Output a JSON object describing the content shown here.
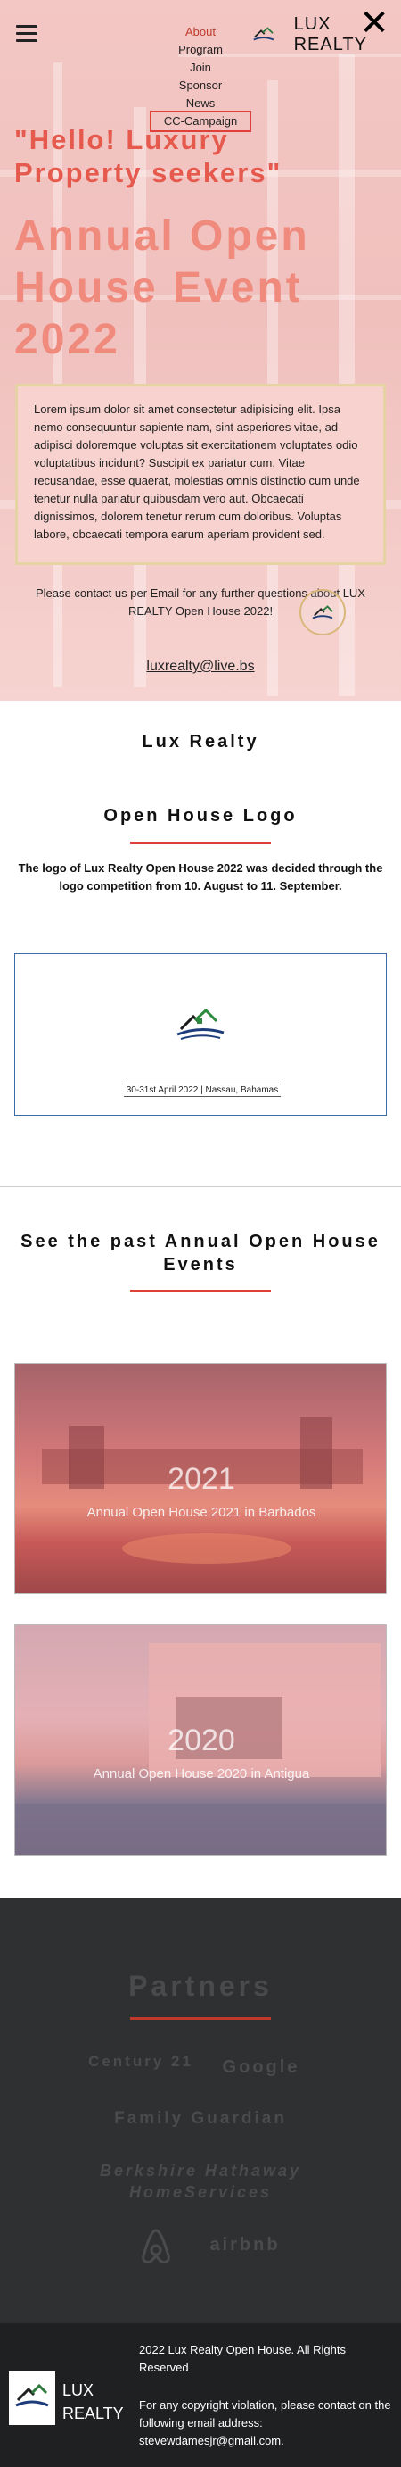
{
  "colors": {
    "accent_red": "#e0403a",
    "hero_pink": "#f3c7c4",
    "dark_bg": "#2f3031",
    "footer_bg": "#1f2021"
  },
  "header": {
    "menu_icon": "hamburger-icon",
    "close_icon": "close-icon",
    "brand": "LUX REALTY",
    "nav": [
      "About",
      "Program",
      "Join",
      "Sponsor",
      "News",
      "CC-Campaign"
    ]
  },
  "hero": {
    "greeting": "\"Hello! Luxury Property seekers\"",
    "title": "Annual Open House Event 2022",
    "lorem": "Lorem ipsum dolor sit amet consectetur adipisicing elit. Ipsa nemo consequuntur sapiente nam, sint asperiores vitae, ad adipisci doloremque voluptas sit exercitationem voluptates odio voluptatibus incidunt? Suscipit ex pariatur cum. Vitae recusandae, esse quaerat, molestias omnis distinctio cum unde tenetur nulla pariatur quibusdam vero aut. Obcaecati dignissimos, dolorem tenetur rerum cum doloribus. Voluptas labore, obcaecati tempora earum aperiam provident sed.",
    "contact": "Please contact us per Email for any further questions about LUX REALTY Open House 2022!",
    "email": "luxrealty@live.bs"
  },
  "about": {
    "title": "Lux Realty"
  },
  "logo_section": {
    "title": "Open House Logo",
    "description": "The logo of Lux Realty Open House 2022 was decided through the logo competition from 10. August to 11. September.",
    "card_caption": "30-31st April 2022 | Nassau, Bahamas"
  },
  "past_events": {
    "title": "See the past Annual Open House Events",
    "events": [
      {
        "year": "2021",
        "subtitle": "Annual Open House 2021 in Barbados"
      },
      {
        "year": "2020",
        "subtitle": "Annual Open House 2020 in Antigua"
      }
    ]
  },
  "partners": {
    "title": "Partners",
    "items": [
      "Century 21",
      "Google",
      "Family Guardian",
      "Berkshire Hathaway HomeServices",
      "airbnb"
    ]
  },
  "footer": {
    "brand_line1": "LUX",
    "brand_line2": "REALTY",
    "copyright": "2022 Lux Realty Open House. All Rights Reserved",
    "contact": "For any copyright violation, please contact on the following email address: stevewdamesjr@gmail.com."
  }
}
